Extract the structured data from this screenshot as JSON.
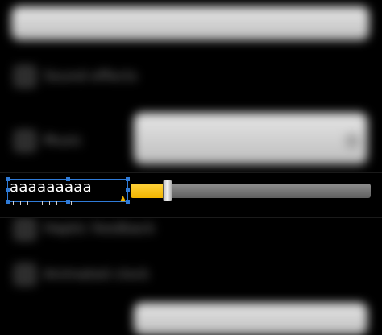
{
  "text_field": {
    "value": "aaaaaaaaa"
  },
  "slider": {
    "fill_fraction": 0.14
  },
  "background": {
    "blurred_rows": [
      "Sound effects",
      "Music",
      "Haptic feedback",
      "Animated clock"
    ],
    "accent_color": "#f2b400",
    "selection_color": "#2f7bd8"
  },
  "icons": {
    "warning": "warning-icon"
  }
}
